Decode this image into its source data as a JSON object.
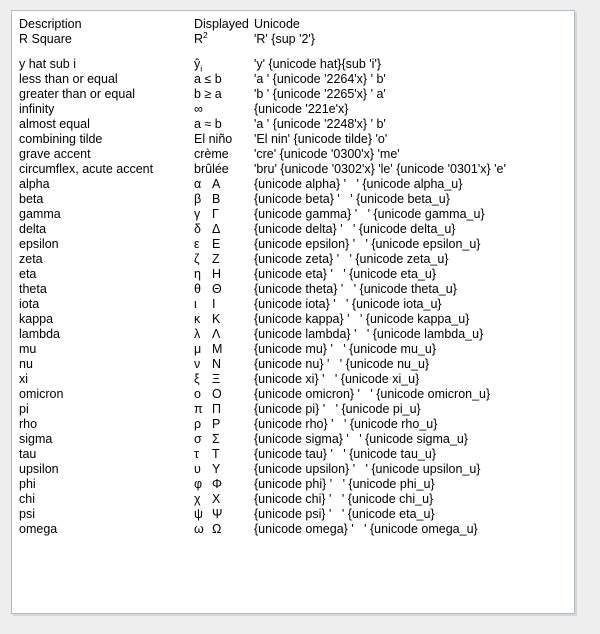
{
  "panel": {
    "columns": {
      "description": "Description",
      "displayed": "Displayed",
      "unicode": "Unicode"
    },
    "rows": [
      {
        "description": "R Square",
        "displayed_base": "R",
        "displayed_sup": "2",
        "unicode": "'R' {sup '2'}",
        "gap_after": true
      },
      {
        "description": "y hat sub i",
        "displayed_base": "ŷ",
        "displayed_sub": "i",
        "unicode": "'y' {unicode hat}{sub 'i'}"
      },
      {
        "description": "less than or equal",
        "displayed": "a ≤ b",
        "unicode": "'a ' {unicode '2264'x} ' b'"
      },
      {
        "description": "greater than or equal",
        "displayed": "b ≥ a",
        "unicode": "'b ' {unicode '2265'x} ' a'"
      },
      {
        "description": "infinity",
        "displayed": "∞",
        "unicode": "{unicode '221e'x}"
      },
      {
        "description": "almost equal",
        "displayed": "a ≈ b",
        "unicode": "'a ' {unicode '2248'x} ' b'"
      },
      {
        "description": "combining tilde",
        "displayed": "El niño",
        "unicode": "'El nin' {unicode tilde} 'o'"
      },
      {
        "description": "grave accent",
        "displayed": "crème",
        "unicode": "'cre' {unicode '0300'x} 'me'"
      },
      {
        "description": "circumflex, acute accent",
        "displayed": "brûlée",
        "unicode": "'bru' {unicode '0302'x} 'le' {unicode '0301'x} 'e'"
      },
      {
        "description": "alpha",
        "displayed_lower": "α",
        "displayed_upper": "Α",
        "unicode": "{unicode alpha} '   ' {unicode alpha_u}"
      },
      {
        "description": "beta",
        "displayed_lower": "β",
        "displayed_upper": "Β",
        "unicode": "{unicode beta} '   ' {unicode beta_u}"
      },
      {
        "description": "gamma",
        "displayed_lower": "γ",
        "displayed_upper": "Γ",
        "unicode": "{unicode gamma} '   ' {unicode gamma_u}"
      },
      {
        "description": "delta",
        "displayed_lower": "δ",
        "displayed_upper": "Δ",
        "unicode": "{unicode delta} '   ' {unicode delta_u}"
      },
      {
        "description": "epsilon",
        "displayed_lower": "ε",
        "displayed_upper": "Ε",
        "unicode": "{unicode epsilon} '   ' {unicode epsilon_u}"
      },
      {
        "description": "zeta",
        "displayed_lower": "ζ",
        "displayed_upper": "Ζ",
        "unicode": "{unicode zeta} '   ' {unicode zeta_u}"
      },
      {
        "description": "eta",
        "displayed_lower": "η",
        "displayed_upper": "Η",
        "unicode": "{unicode eta} '   ' {unicode eta_u}"
      },
      {
        "description": "theta",
        "displayed_lower": "θ",
        "displayed_upper": "Θ",
        "unicode": "{unicode theta} '   ' {unicode theta_u}"
      },
      {
        "description": "iota",
        "displayed_lower": "ι",
        "displayed_upper": "Ι",
        "unicode": "{unicode iota} '   ' {unicode iota_u}"
      },
      {
        "description": "kappa",
        "displayed_lower": "κ",
        "displayed_upper": "Κ",
        "unicode": "{unicode kappa} '   ' {unicode kappa_u}"
      },
      {
        "description": "lambda",
        "displayed_lower": "λ",
        "displayed_upper": "Λ",
        "unicode": "{unicode lambda} '   ' {unicode lambda_u}"
      },
      {
        "description": "mu",
        "displayed_lower": "μ",
        "displayed_upper": "Μ",
        "unicode": "{unicode mu} '   ' {unicode mu_u}"
      },
      {
        "description": "nu",
        "displayed_lower": "ν",
        "displayed_upper": "Ν",
        "unicode": "{unicode nu} '   ' {unicode nu_u}"
      },
      {
        "description": "xi",
        "displayed_lower": "ξ",
        "displayed_upper": "Ξ",
        "unicode": "{unicode xi} '   ' {unicode xi_u}"
      },
      {
        "description": "omicron",
        "displayed_lower": "ο",
        "displayed_upper": "Ο",
        "unicode": "{unicode omicron} '   ' {unicode omicron_u}"
      },
      {
        "description": "pi",
        "displayed_lower": "π",
        "displayed_upper": "Π",
        "unicode": "{unicode pi} '   ' {unicode pi_u}"
      },
      {
        "description": "rho",
        "displayed_lower": "ρ",
        "displayed_upper": "Ρ",
        "unicode": "{unicode rho} '   ' {unicode rho_u}"
      },
      {
        "description": "sigma",
        "displayed_lower": "σ",
        "displayed_upper": "Σ",
        "unicode": "{unicode sigma} '   ' {unicode sigma_u}"
      },
      {
        "description": "tau",
        "displayed_lower": "τ",
        "displayed_upper": "Τ",
        "unicode": "{unicode tau} '   ' {unicode tau_u}"
      },
      {
        "description": "upsilon",
        "displayed_lower": "υ",
        "displayed_upper": "Υ",
        "unicode": "{unicode upsilon} '   ' {unicode upsilon_u}"
      },
      {
        "description": "phi",
        "displayed_lower": "φ",
        "displayed_upper": "Φ",
        "unicode": "{unicode phi} '   ' {unicode phi_u}"
      },
      {
        "description": "chi",
        "displayed_lower": "χ",
        "displayed_upper": "Χ",
        "unicode": "{unicode chi} '   ' {unicode chi_u}"
      },
      {
        "description": "psi",
        "displayed_lower": "ψ",
        "displayed_upper": "Ψ",
        "unicode": "{unicode psi} '   ' {unicode eta_u}"
      },
      {
        "description": "omega",
        "displayed_lower": "ω",
        "displayed_upper": "Ω",
        "unicode": "{unicode omega} '   ' {unicode omega_u}"
      }
    ]
  }
}
